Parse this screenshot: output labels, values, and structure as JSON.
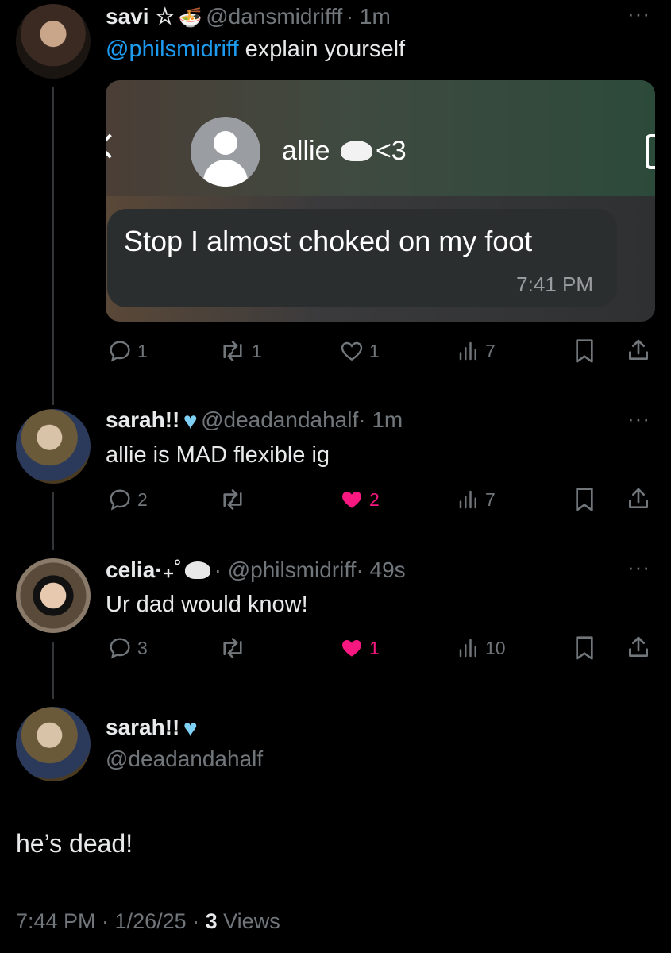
{
  "tweet1": {
    "name": "savi ☆",
    "emoji": "🍜",
    "handle": "@dansmidrifff",
    "time": "· 1m",
    "mention": "@philsmidriff",
    "text": " explain yourself",
    "image": {
      "contact_name": "allie",
      "contact_suffix": "<3",
      "message": "Stop I almost choked on my foot",
      "message_time": "7:41 PM"
    },
    "replies": "1",
    "retweets": "1",
    "likes": "1",
    "views": "7"
  },
  "tweet2": {
    "name": "sarah!!",
    "handle": "@deadandahalf",
    "time": "· 1m",
    "text": "allie is MAD flexible ig",
    "replies": "2",
    "likes": "2",
    "views": "7"
  },
  "tweet3": {
    "name": "celia·₊˚",
    "handle": "· @philsmidriff",
    "time": "· 49s",
    "text": "Ur dad would know!",
    "replies": "3",
    "likes": "1",
    "views": "10"
  },
  "main": {
    "name": "sarah!!",
    "handle": "@deadandahalf",
    "text": "he’s dead!",
    "time": "7:44 PM · 1/26/25 · ",
    "views_count": "3",
    "views_label": " Views"
  },
  "colors": {
    "accent": "#1d9bf0",
    "like": "#f91880",
    "muted": "#71767b",
    "verified": "#7fd0f5"
  }
}
